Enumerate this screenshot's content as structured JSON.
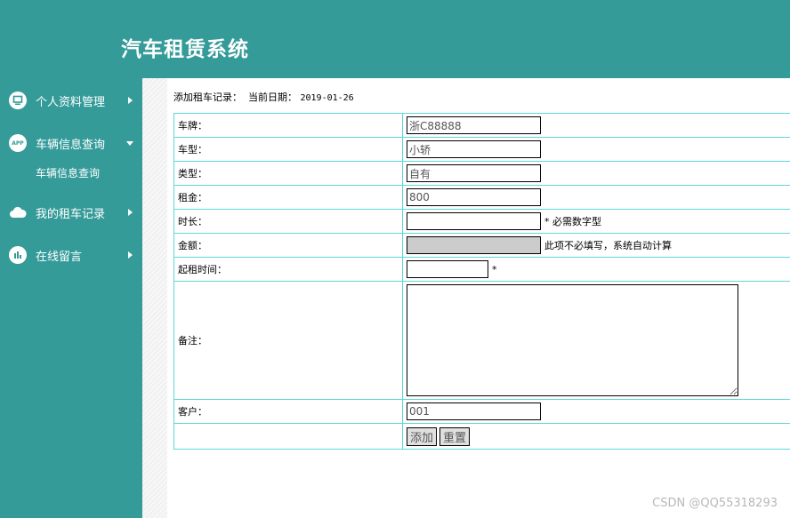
{
  "header": {
    "title": "汽车租赁系统"
  },
  "sidebar": {
    "items": [
      {
        "label": "个人资料管理",
        "icon": "monitor-icon"
      },
      {
        "label": "车辆信息查询",
        "icon": "app-icon",
        "expanded": true,
        "sub": [
          "车辆信息查询"
        ]
      },
      {
        "label": "我的租车记录",
        "icon": "cloud-icon"
      },
      {
        "label": "在线留言",
        "icon": "bar-chart-icon"
      }
    ],
    "app_icon_text": "APP"
  },
  "form": {
    "heading": "添加租车记录：  当前日期：",
    "date": "2019-01-26",
    "fields": {
      "plate": {
        "label": "车牌：",
        "value": "浙C88888"
      },
      "model": {
        "label": "车型：",
        "value": "小轿"
      },
      "type": {
        "label": "类型：",
        "value": "自有"
      },
      "rent": {
        "label": "租金：",
        "value": "800"
      },
      "duration": {
        "label": "时长：",
        "value": "",
        "hint": "* 必需数字型"
      },
      "amount": {
        "label": "金额：",
        "value": "",
        "hint": "此项不必填写，系统自动计算"
      },
      "start_time": {
        "label": "起租时间：",
        "value": "",
        "hint": "*"
      },
      "remark": {
        "label": "备注：",
        "value": ""
      },
      "customer": {
        "label": "客户：",
        "value": "001"
      }
    },
    "buttons": {
      "add": "添加",
      "reset": "重置"
    }
  },
  "watermark": "CSDN @QQ55318293",
  "colors": {
    "primary": "#349b99",
    "table_border": "#5fd6d6",
    "disabled_field": "#cccccc"
  }
}
